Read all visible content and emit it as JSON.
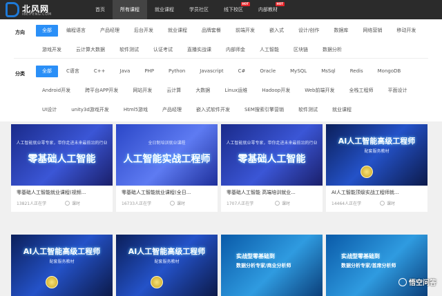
{
  "logo": {
    "text": "北风网",
    "sub": "IBEIFENG.COM"
  },
  "nav": [
    {
      "label": "首页",
      "hot": ""
    },
    {
      "label": "所有课程",
      "hot": ""
    },
    {
      "label": "就业课程",
      "hot": ""
    },
    {
      "label": "学员社区",
      "hot": ""
    },
    {
      "label": "线下校区",
      "hot": "HOT"
    },
    {
      "label": "内部教材",
      "hot": "HOT"
    }
  ],
  "direction": {
    "label": "方向",
    "tags": [
      "全部",
      "编程语言",
      "产品经理",
      "后台开发",
      "就业课程",
      "品牌套餐",
      "前端开发",
      "嵌入式",
      "设计/创作",
      "数据库",
      "网络营销",
      "移动开发",
      "游戏开发",
      "云计算大数据",
      "软件测试",
      "认证考试",
      "直播实战课",
      "内部师金",
      "人工智能",
      "区块链",
      "数据分析"
    ]
  },
  "category": {
    "label": "分类",
    "tags": [
      "全部",
      "C语言",
      "C++",
      "Java",
      "PHP",
      "Python",
      "Javascript",
      "C#",
      "Oracle",
      "MySQL",
      "MsSql",
      "Redis",
      "MongoDB",
      "Android开发",
      "跨平台APP开发",
      "网站开发",
      "云计算",
      "大数据",
      "Linux运维",
      "Hadoop开发",
      "Web前端开发",
      "全栈工程师",
      "平面设计",
      "UI设计",
      "unity3d游戏开发",
      "Html5游戏",
      "产品经理",
      "嵌入式软件开发",
      "SEM搜索引擎营销",
      "软件测试",
      "就业课程"
    ]
  },
  "courses": [
    {
      "thumb_title": "零基础人工智能",
      "thumb_sub": "人工智能就业零专家，带你走进未来最前沿的行业",
      "title": "零基础人工智能就业课程(视频...",
      "people": "13821人正在学",
      "meta": "课时"
    },
    {
      "thumb_title": "人工智能实战工程师",
      "thumb_sub": "全日制培训就业课程",
      "title": "零基础人工智能就业课程(全日...",
      "people": "16733人正在学",
      "meta": "课时"
    },
    {
      "thumb_title": "零基础人工智能",
      "thumb_sub": "人工智能就业零专家，带你走进未来最前沿的行业",
      "title": "零基础人工智能 高端培训就业...",
      "people": "1707人正在学",
      "meta": "课时"
    },
    {
      "thumb_title": "AI人工智能高级工程师",
      "thumb_sub": "配套服务教材",
      "title": "AI人工智能顶级实战工程师就...",
      "people": "14464人正在学",
      "meta": "课时"
    },
    {
      "thumb_title": "AI人工智能高级工程师",
      "thumb_sub": "配套服务教材",
      "title": "",
      "people": "",
      "meta": ""
    },
    {
      "thumb_title": "AI人工智能高级工程师",
      "thumb_sub": "配套服务教材",
      "title": "",
      "people": "",
      "meta": ""
    },
    {
      "thumb_title": "实战型零基础到",
      "thumb_sub": "数据分析专家/商业分析师",
      "title": "",
      "people": "",
      "meta": ""
    },
    {
      "thumb_title": "实战型零基础到",
      "thumb_sub": "数据分析专家/首席分析师",
      "title": "",
      "people": "",
      "meta": ""
    }
  ],
  "watermark": "悟空问答",
  "colors": {
    "accent": "#2a8ff7",
    "topbar": "#2b2b2b",
    "hot": "#e5262b"
  }
}
